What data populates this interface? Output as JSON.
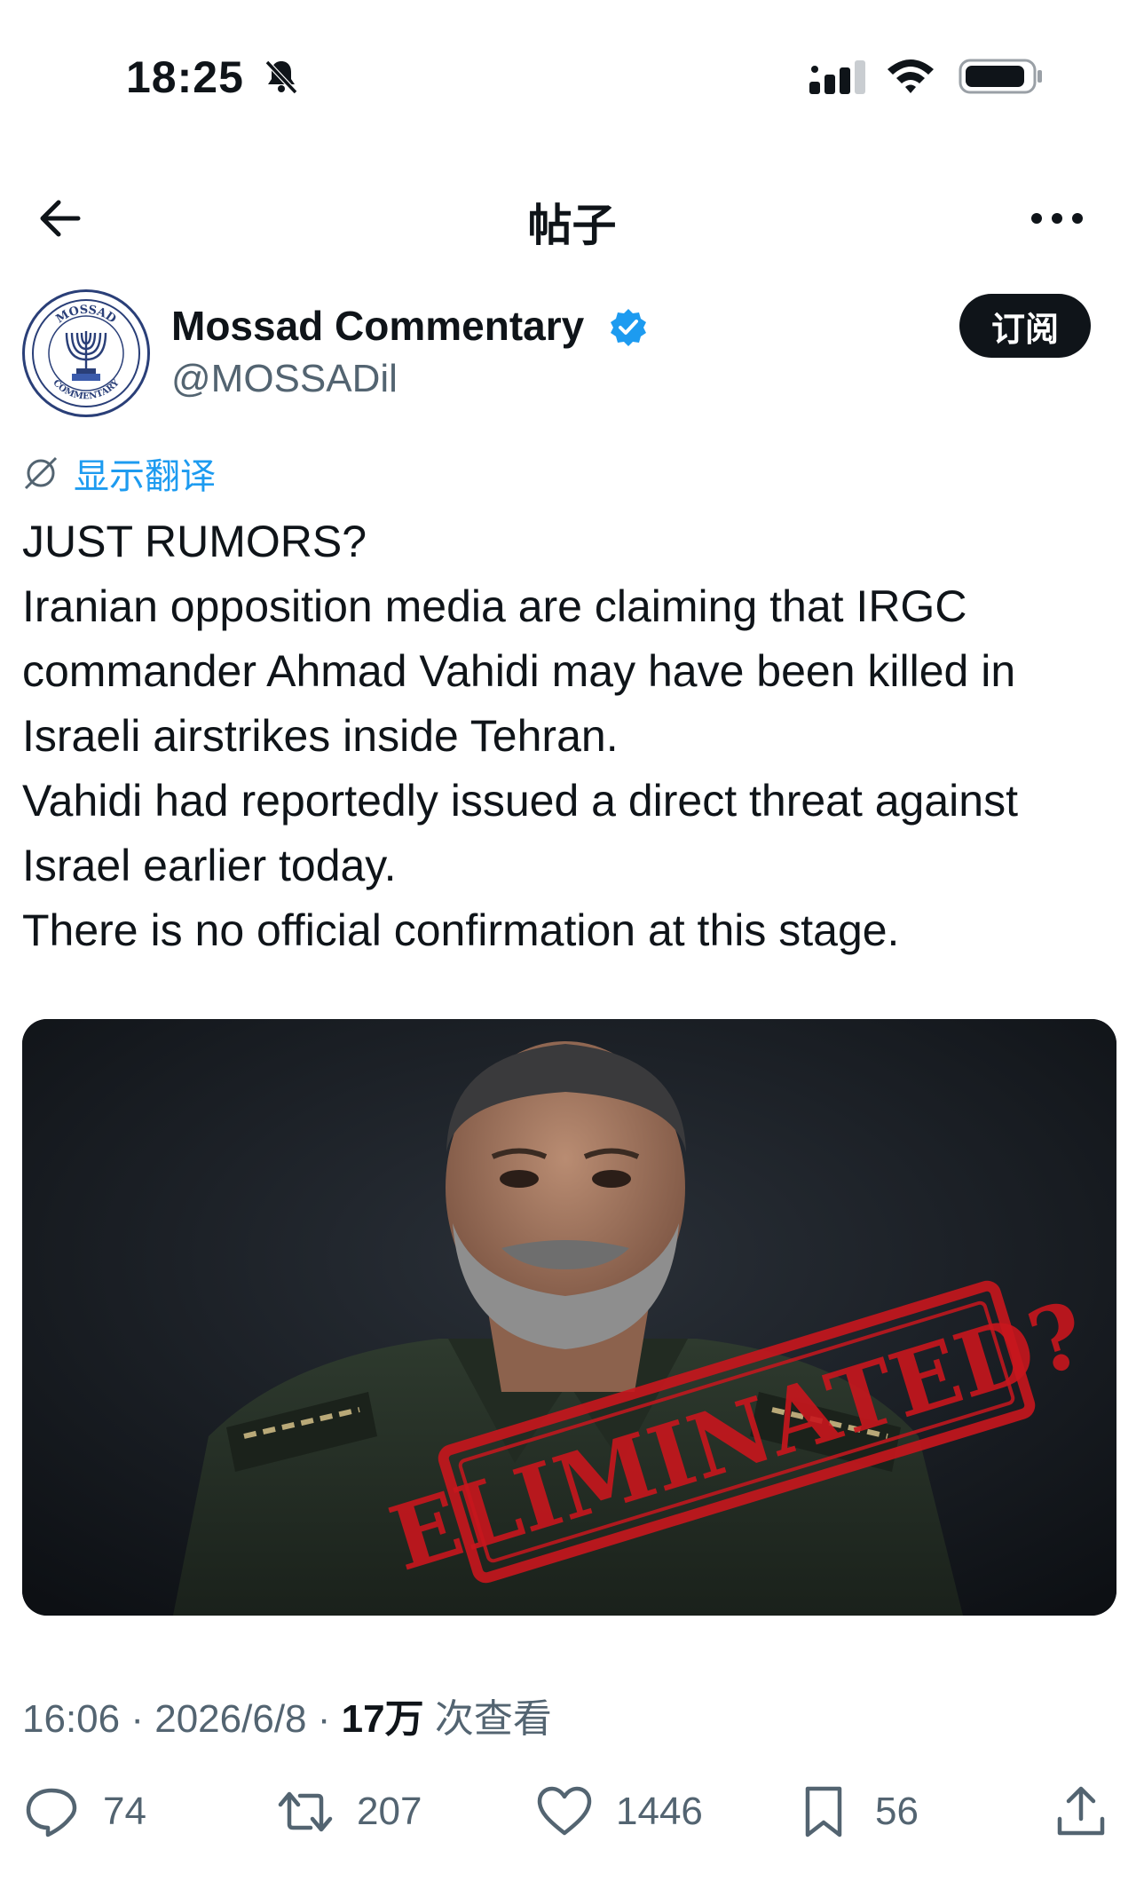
{
  "status_bar": {
    "time": "18:25"
  },
  "nav": {
    "title": "帖子"
  },
  "author": {
    "name": "Mossad Commentary",
    "handle": "@MOSSADil",
    "verified": true,
    "subscribe_label": "订阅",
    "avatar_text_top": "MOSSAD",
    "avatar_text_bottom": "COMMENTARY"
  },
  "translate": {
    "label": "显示翻译"
  },
  "post": {
    "lines": [
      "JUST RUMORS?",
      "Iranian opposition media are claiming that IRGC",
      "commander Ahmad Vahidi may have been killed in",
      "Israeli airstrikes inside Tehran.",
      "Vahidi had reportedly issued a direct threat against",
      "Israel earlier today.",
      "There is no official confirmation at this stage."
    ],
    "image_stamp": "ELIMINATED?"
  },
  "meta": {
    "time": "16:06",
    "date": "2026/6/8",
    "views": "17万",
    "views_suffix": "次查看",
    "separator": "·"
  },
  "actions": {
    "replies": "74",
    "reposts": "207",
    "likes": "1446",
    "bookmarks": "56"
  },
  "colors": {
    "accent": "#1d9bf0",
    "text": "#0f1419",
    "secondary": "#536471",
    "stamp": "#c8161d"
  }
}
